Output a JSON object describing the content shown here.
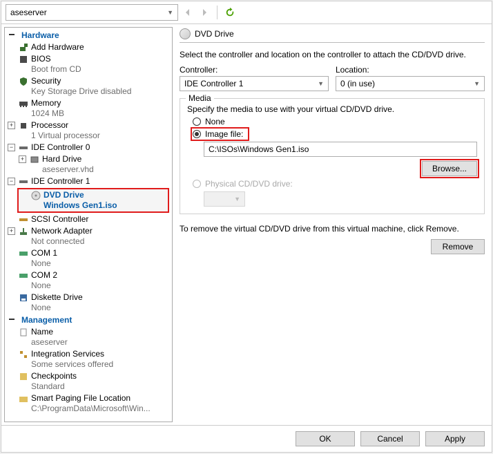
{
  "toolbar": {
    "vm_name": "aseserver"
  },
  "sections": {
    "hardware": "Hardware",
    "management": "Management"
  },
  "hardware": {
    "add_hardware": "Add Hardware",
    "bios": "BIOS",
    "bios_sub": "Boot from CD",
    "security": "Security",
    "security_sub": "Key Storage Drive disabled",
    "memory": "Memory",
    "memory_sub": "1024 MB",
    "processor": "Processor",
    "processor_sub": "1 Virtual processor",
    "ide0": "IDE Controller 0",
    "hard_drive": "Hard Drive",
    "hard_drive_sub": "aseserver.vhd",
    "ide1": "IDE Controller 1",
    "dvd_drive": "DVD Drive",
    "dvd_sub": "Windows Gen1.iso",
    "scsi": "SCSI Controller",
    "net": "Network Adapter",
    "net_sub": "Not connected",
    "com1": "COM 1",
    "com1_sub": "None",
    "com2": "COM 2",
    "com2_sub": "None",
    "diskette": "Diskette Drive",
    "diskette_sub": "None"
  },
  "management": {
    "name": "Name",
    "name_sub": "aseserver",
    "integration": "Integration Services",
    "integration_sub": "Some services offered",
    "checkpoints": "Checkpoints",
    "checkpoints_sub": "Standard",
    "smart_paging": "Smart Paging File Location",
    "smart_paging_sub": "C:\\ProgramData\\Microsoft\\Win..."
  },
  "details": {
    "title": "DVD Drive",
    "description": "Select the controller and location on the controller to attach the CD/DVD drive.",
    "controller_label": "Controller:",
    "controller_value": "IDE Controller 1",
    "location_label": "Location:",
    "location_value": "0 (in use)",
    "media_legend": "Media",
    "media_desc": "Specify the media to use with your virtual CD/DVD drive.",
    "radio_none": "None",
    "radio_image": "Image file:",
    "image_path": "C:\\ISOs\\Windows Gen1.iso",
    "browse": "Browse...",
    "radio_physical": "Physical CD/DVD drive:",
    "remove_text": "To remove the virtual CD/DVD drive from this virtual machine, click Remove.",
    "remove_btn": "Remove"
  },
  "footer": {
    "ok": "OK",
    "cancel": "Cancel",
    "apply": "Apply"
  }
}
